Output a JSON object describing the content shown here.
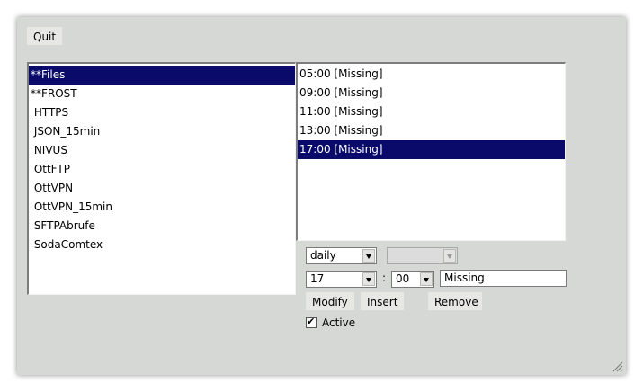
{
  "toolbar": {
    "quit_label": "Quit"
  },
  "groups": [
    {
      "label": "**Files",
      "selected": true
    },
    {
      "label": "**FROST",
      "selected": false
    },
    {
      "label": " HTTPS",
      "selected": false
    },
    {
      "label": " JSON_15min",
      "selected": false
    },
    {
      "label": " NIVUS",
      "selected": false
    },
    {
      "label": " OttFTP",
      "selected": false
    },
    {
      "label": " OttVPN",
      "selected": false
    },
    {
      "label": " OttVPN_15min",
      "selected": false
    },
    {
      "label": " SFTPAbrufe",
      "selected": false
    },
    {
      "label": " SodaComtex",
      "selected": false
    }
  ],
  "schedules": [
    {
      "label": "05:00 [Missing]",
      "selected": false
    },
    {
      "label": "09:00 [Missing]",
      "selected": false
    },
    {
      "label": "11:00 [Missing]",
      "selected": false
    },
    {
      "label": "13:00 [Missing]",
      "selected": false
    },
    {
      "label": "17:00 [Missing]",
      "selected": true
    }
  ],
  "editor": {
    "frequency": "daily",
    "day": "",
    "hour": "17",
    "separator": ":",
    "minute": "00",
    "description": "Missing",
    "modify_label": "Modify",
    "insert_label": "Insert",
    "remove_label": "Remove",
    "active_label": "Active",
    "active_checked": true,
    "check_mark": "✔"
  },
  "colors": {
    "selection": "#0a0a6a",
    "window": "#d5d8d5"
  }
}
